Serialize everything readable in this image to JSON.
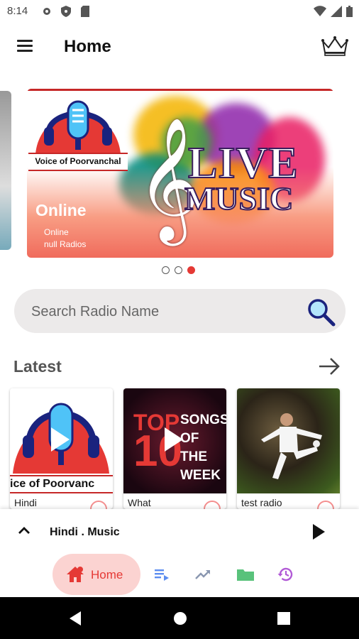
{
  "status_bar": {
    "time": "8:14"
  },
  "app_bar": {
    "title": "Home"
  },
  "banner": {
    "logo_text": "Voice of Poorvanchal",
    "headline_1": "LIVE",
    "headline_2": "MUSIC",
    "status": "Online",
    "line1": "Online",
    "line2": "null Radios"
  },
  "carousel": {
    "pages": 3,
    "active_index": 2
  },
  "search": {
    "placeholder": "Search Radio Name",
    "value": ""
  },
  "latest": {
    "title": "Latest",
    "cards": [
      {
        "name": "Hindi",
        "thumb_label": "ice of Poorvanc"
      },
      {
        "name": "What",
        "thumb_top": "TOP",
        "thumb_num": "10",
        "thumb_lines": [
          "SONGS",
          "OF THE",
          "WEEK"
        ]
      },
      {
        "name": "test radio"
      }
    ]
  },
  "mini_player": {
    "now_playing": "Hindi . Music"
  },
  "bottom_nav": {
    "home": "Home"
  },
  "colors": {
    "accent": "#e53935",
    "home_pill": "#fbd3d1",
    "playlist": "#5c8df0",
    "trending": "#8a97b0",
    "folder": "#59c27b",
    "history": "#b15ad6"
  }
}
